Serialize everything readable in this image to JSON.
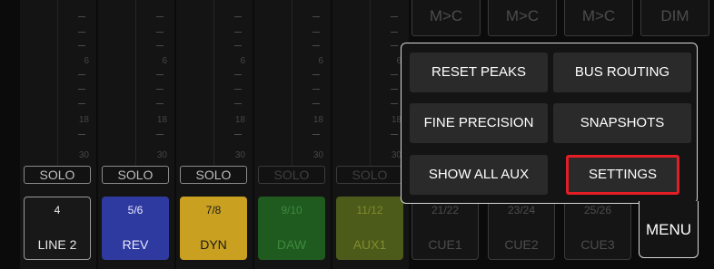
{
  "meter_scale": [
    "6",
    "18",
    "30"
  ],
  "strips": [
    {
      "solo": "SOLO",
      "num": "4",
      "name": "LINE 2",
      "bg": "#181818",
      "fg": "#e6e6e6",
      "border": "#9a9a9a",
      "dim": false
    },
    {
      "solo": "SOLO",
      "num": "5/6",
      "name": "REV",
      "bg": "#2f3aa0",
      "fg": "#e8e8ff",
      "border": "#2f3aa0",
      "dim": false
    },
    {
      "solo": "SOLO",
      "num": "7/8",
      "name": "DYN",
      "bg": "#c9a020",
      "fg": "#1a1a1a",
      "border": "#c9a020",
      "dim": false
    },
    {
      "solo": "SOLO",
      "num": "9/10",
      "name": "DAW",
      "bg": "#1f5a1f",
      "fg": "#3d8a3d",
      "border": "#1f5a1f",
      "dim": true
    },
    {
      "solo": "SOLO",
      "num": "11/12",
      "name": "AUX1",
      "bg": "#4c5a1a",
      "fg": "#7d8f2e",
      "border": "#4c5a1a",
      "dim": true
    }
  ],
  "cues": [
    {
      "num": "21/22",
      "name": "CUE1",
      "top": "M>C"
    },
    {
      "num": "23/24",
      "name": "CUE2",
      "top": "M>C"
    },
    {
      "num": "25/26",
      "name": "CUE3",
      "top": "M>C"
    }
  ],
  "dim_label": "DIM",
  "menu": {
    "buttons": [
      {
        "label": "RESET PEAKS",
        "highlight": false
      },
      {
        "label": "BUS ROUTING",
        "highlight": false
      },
      {
        "label": "FINE PRECISION",
        "highlight": false
      },
      {
        "label": "SNAPSHOTS",
        "highlight": false
      },
      {
        "label": "SHOW ALL AUX",
        "highlight": false
      },
      {
        "label": "SETTINGS",
        "highlight": true
      }
    ],
    "tab_label": "MENU"
  }
}
